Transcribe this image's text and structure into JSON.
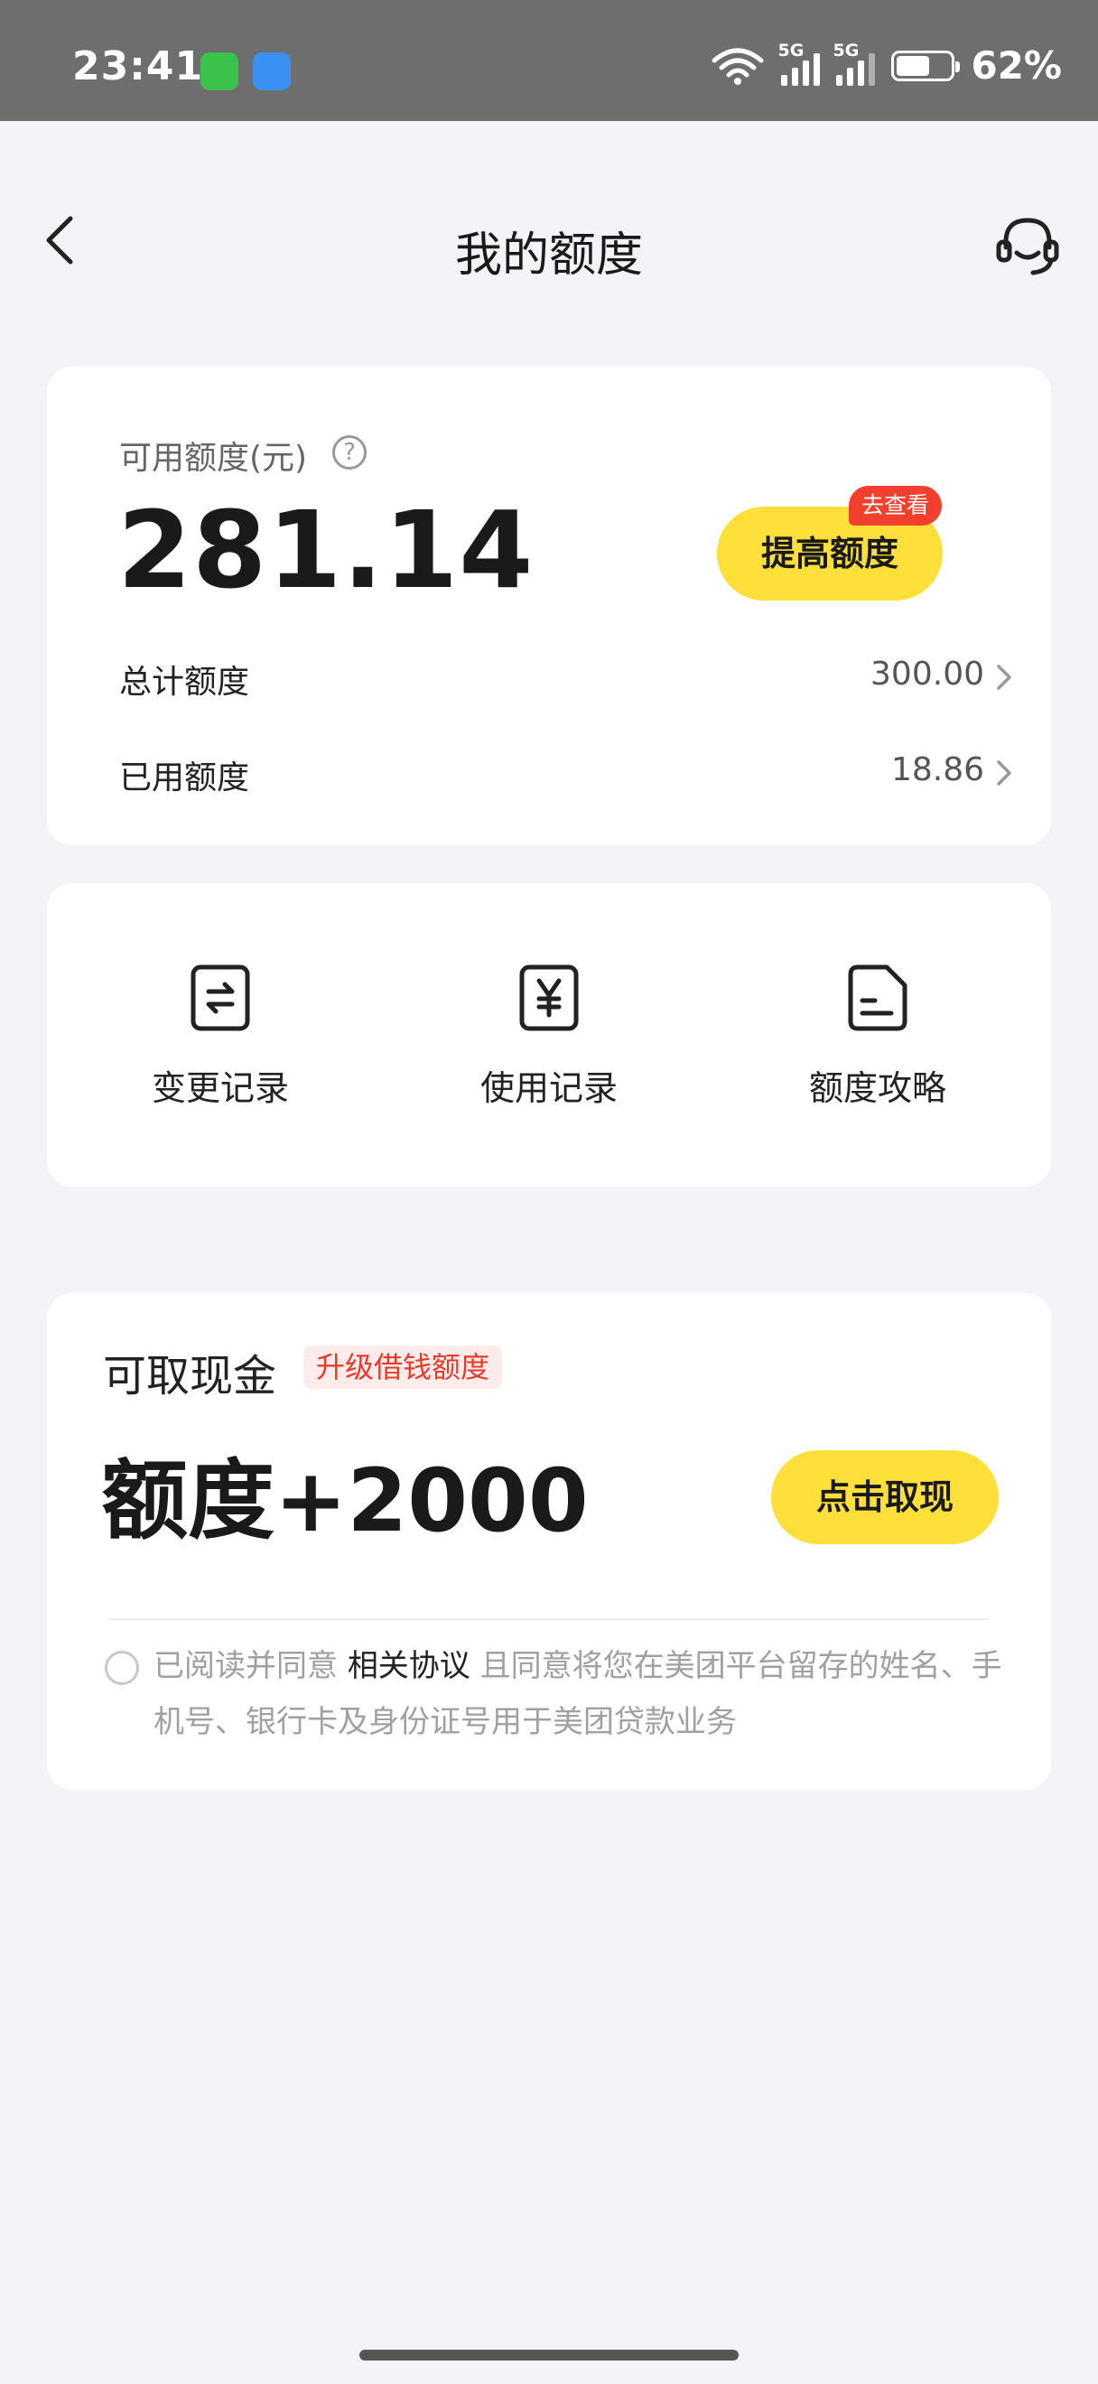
{
  "status_bar": {
    "time": "23:41",
    "app_icons": [
      "messages-icon",
      "weather-icon"
    ],
    "signal1_tag": "5G",
    "signal2_tag": "5G",
    "battery_level": 0.62,
    "battery_pct": "62%"
  },
  "nav": {
    "title": "我的额度",
    "back_icon": "back-chevron-icon",
    "service_icon": "customer-service-icon"
  },
  "quota": {
    "available_label": "可用额度(元)",
    "help_glyph": "?",
    "available_value": "281.14",
    "raise_button": "提高额度",
    "raise_badge": "去查看",
    "total_label": "总计额度",
    "total_value": "300.00",
    "used_label": "已用额度",
    "used_value": "18.86"
  },
  "shortcuts": [
    {
      "label": "变更记录",
      "icon": "exchange-doc-icon"
    },
    {
      "label": "使用记录",
      "icon": "yuan-doc-icon"
    },
    {
      "label": "额度攻略",
      "icon": "guide-doc-icon"
    }
  ],
  "cash": {
    "label": "可取现金",
    "tag": "升级借钱额度",
    "value": "额度+2000",
    "button": "点击取现",
    "agree_prefix": "已阅读并同意 ",
    "agree_link": "相关协议",
    "agree_suffix": " 且同意将您在美团平台留存的姓名、手机号、银行卡及身份证号用于美团贷款业务"
  },
  "colors": {
    "accent_yellow": "#ffe03a",
    "badge_red": "#f23f2e",
    "tag_red": "#e63a2b",
    "page_bg": "#f3f4f8"
  }
}
